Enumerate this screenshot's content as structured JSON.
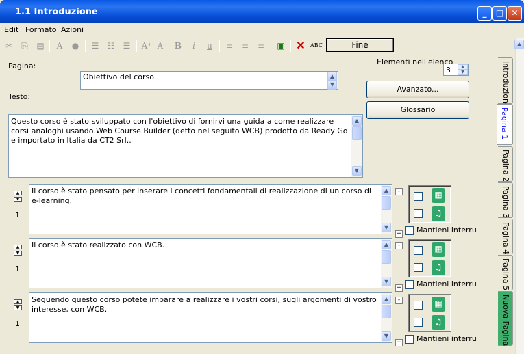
{
  "window": {
    "title": "1.1 Introduzione"
  },
  "menu": {
    "items": [
      "Edit",
      "Formato",
      "Azioni"
    ]
  },
  "toolbar": {
    "fine_label": "Fine"
  },
  "form": {
    "pagina_label": "Pagina:",
    "pagina_value": "Obiettivo del corso",
    "testo_label": "Testo:",
    "testo_value": "Questo corso è stato sviluppato con l'obiettivo di fornirvi una guida a come realizzare corsi analoghi usando Web Course Builder (detto nel seguito WCB) prodotto da Ready Go e importato in Italia da CT2 Srl..",
    "elementi_label": "Elementi nell'elenco",
    "elementi_value": "3",
    "avanzato_label": "Avanzato...",
    "glossario_label": "Glossario"
  },
  "paragraphs": [
    {
      "text": "Il corso è stato pensato per inserare i concetti fondamentali di realizzazione di un corso di e-learning.",
      "number": "1",
      "keep_label": "Mantieni interruzioni"
    },
    {
      "text": "Il corso è stato realizzato con WCB.",
      "number": "1",
      "keep_label": "Mantieni interruzioni"
    },
    {
      "text": "Seguendo questo corso potete imparare a realizzare i vostri corsi, sugli argomenti di vostro interesse, con WCB.",
      "number": "1",
      "keep_label": "Mantieni interruzioni"
    }
  ],
  "tabs": [
    "Introduzione",
    "Pagina 1",
    "Pagina 2",
    "Pagina 3",
    "Pagina 4",
    "Pagina 5",
    "Nuova Pagina"
  ],
  "colors": {
    "titlebar": "#0a5ae6",
    "tab_active_text": "#0000ff",
    "tab_new": "#3fae6c"
  }
}
